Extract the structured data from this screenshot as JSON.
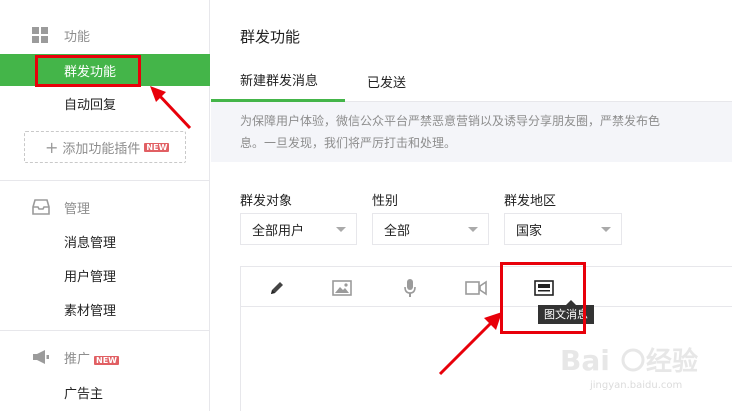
{
  "sidebar": {
    "features": {
      "section_label": "功能",
      "items": [
        {
          "label": "群发功能"
        },
        {
          "label": "自动回复"
        }
      ],
      "add_plugin_label": "添加功能插件",
      "new_badge": "NEW"
    },
    "manage": {
      "section_label": "管理",
      "items": [
        {
          "label": "消息管理"
        },
        {
          "label": "用户管理"
        },
        {
          "label": "素材管理"
        }
      ]
    },
    "promote": {
      "section_label": "推广",
      "new_badge": "NEW",
      "items": [
        {
          "label": "广告主"
        }
      ]
    }
  },
  "main": {
    "title": "群发功能",
    "tabs": [
      {
        "label": "新建群发消息",
        "active": true
      },
      {
        "label": "已发送",
        "active": false
      }
    ],
    "notice_line1": "为保障用户体验，微信公众平台严禁恶意营销以及诱导分享朋友圈，严禁发布色",
    "notice_line2": "息。一旦发现，我们将严厉打击和处理。",
    "filters": {
      "target": {
        "label": "群发对象",
        "value": "全部用户"
      },
      "gender": {
        "label": "性别",
        "value": "全部"
      },
      "region": {
        "label": "群发地区",
        "value": "国家"
      }
    },
    "editor": {
      "tools": [
        {
          "name": "pencil-icon"
        },
        {
          "name": "image-icon"
        },
        {
          "name": "microphone-icon"
        },
        {
          "name": "video-icon"
        },
        {
          "name": "news-icon"
        }
      ],
      "tooltip": "图文消息"
    }
  },
  "colors": {
    "accent": "#44b549",
    "annotation": "#e8000a",
    "border": "#e7e7eb",
    "muted_text": "#8d8d8d"
  }
}
